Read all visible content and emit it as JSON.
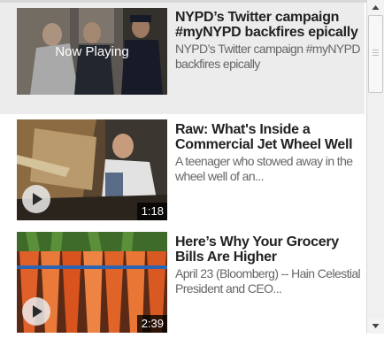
{
  "items": [
    {
      "title": "NYPD’s Twitter campaign #myNYPD backfires epically",
      "description": "NYPD’s Twitter campaign #myNYPD backfires epically",
      "overlay": "Now Playing",
      "active": true
    },
    {
      "title": "Raw: What's Inside a Commercial Jet Wheel Well",
      "description": "A teenager who stowed away in the wheel well of an...",
      "duration": "1:18",
      "active": false
    },
    {
      "title": "Here’s Why Your Grocery Bills Are Higher",
      "description": "April 23 (Bloomberg) -- Hain Celestial President and CEO...",
      "duration": "2:39",
      "active": false
    }
  ],
  "icons": {
    "play": "play-icon",
    "scroll_up": "chevron-up-icon",
    "scroll_down": "chevron-down-icon"
  },
  "colors": {
    "active_background": "#ececec",
    "title": "#222222",
    "description": "#666666"
  }
}
